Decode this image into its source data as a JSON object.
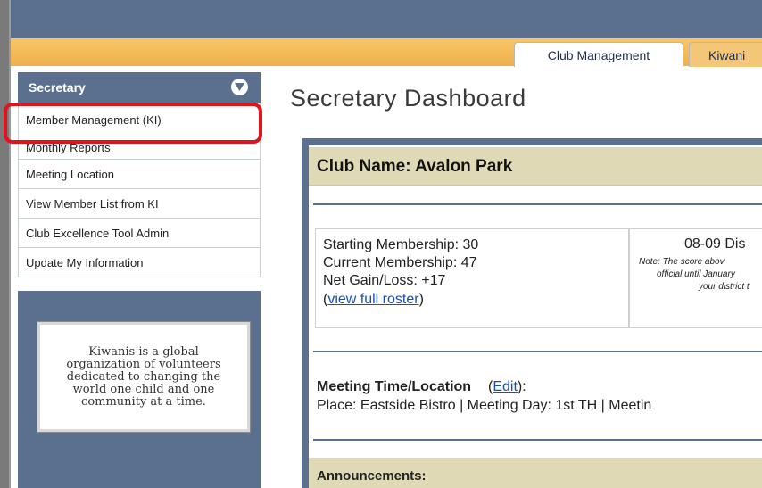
{
  "tabs": [
    {
      "label": "Club Management",
      "active": true
    },
    {
      "label": "Kiwani",
      "active": false
    }
  ],
  "sidebar": {
    "title": "Secretary",
    "items": [
      {
        "label": "Member Management (KI)",
        "highlighted": true
      },
      {
        "label": "Monthly Reports"
      },
      {
        "label": "Meeting Location"
      },
      {
        "label": "View Member List from KI"
      },
      {
        "label": "Club Excellence Tool Admin"
      },
      {
        "label": "Update My Information"
      }
    ],
    "quote": "Kiwanis is a global organization of volunteers dedicated to changing the world one child and one community at a time."
  },
  "main": {
    "title": "Secretary Dashboard",
    "club_name": "Club Name: Avalon Park",
    "stats": {
      "starting": "Starting Membership: 30",
      "current": "Current Membership: 47",
      "net": "Net Gain/Loss: +17",
      "roster_open": "(",
      "roster_link": "view full roster",
      "roster_close": ")"
    },
    "distinguished": {
      "title": "08-09 Dis",
      "note_line1": "Note: The score abov",
      "note_line2": "official until January",
      "note_line3": "your district t"
    },
    "meeting": {
      "label": "Meeting Time/Location",
      "edit_open": " (",
      "edit_link": "Edit",
      "edit_close": "):",
      "place": "Place: Eastside Bistro  |  Meeting Day:   1st TH  |  Meetin"
    },
    "announcements": "Announcements:"
  },
  "colors": {
    "header_blue": "#5b6f8f",
    "tab_orange": "#f0b04c",
    "club_bar": "#e0d9b6",
    "highlight_red": "#e0141b",
    "link": "#1a4fb0"
  }
}
